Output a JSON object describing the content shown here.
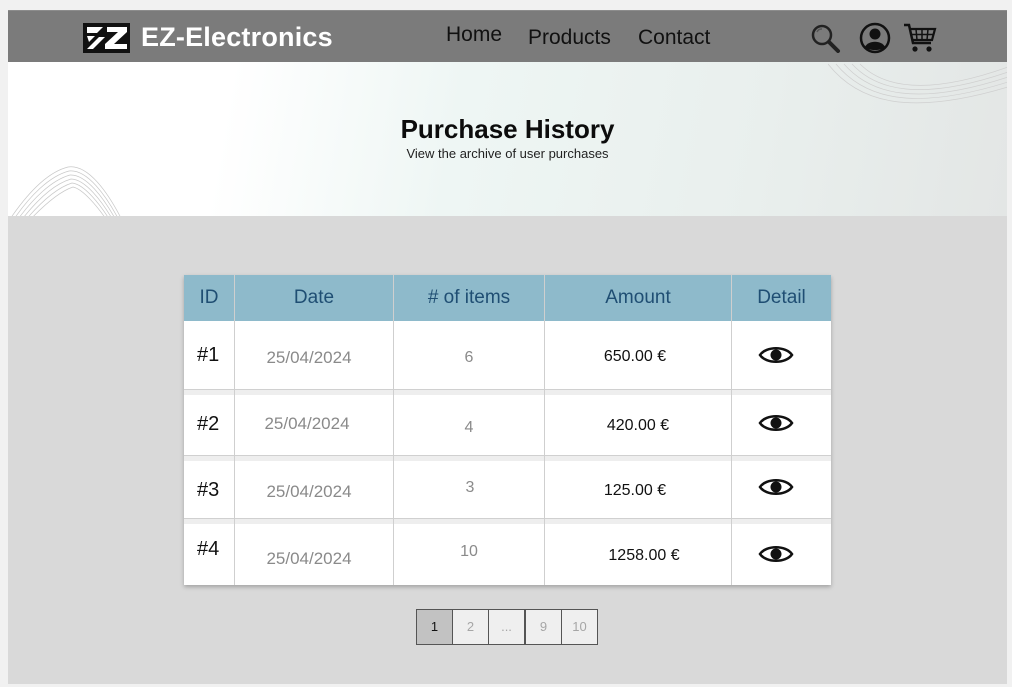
{
  "header": {
    "brand": "EZ-Electronics",
    "nav": {
      "home": "Home",
      "products": "Products",
      "contact": "Contact"
    },
    "icons": [
      "search-icon",
      "user-account-icon",
      "shopping-cart-icon"
    ]
  },
  "hero": {
    "title": "Purchase History",
    "subtitle": "View the archive of user purchases"
  },
  "table": {
    "headers": {
      "id": "ID",
      "date": "Date",
      "items": "# of items",
      "amount": "Amount",
      "detail": "Detail"
    },
    "rows": [
      {
        "id": "#1",
        "date": "25/04/2024",
        "items": "6",
        "amount": "650.00 €"
      },
      {
        "id": "#2",
        "date": "25/04/2024",
        "items": "4",
        "amount": "420.00 €"
      },
      {
        "id": "#3",
        "date": "25/04/2024",
        "items": "3",
        "amount": "125.00 €"
      },
      {
        "id": "#4",
        "date": "25/04/2024",
        "items": "10",
        "amount": "1258.00 €"
      }
    ],
    "detail_icon": "eye-icon"
  },
  "pagination": {
    "pages": [
      "1",
      "2",
      "...",
      "9",
      "10"
    ],
    "current": "1"
  },
  "colors": {
    "header_bg": "#7b7b7b",
    "table_header_bg": "#8ebacb",
    "table_header_text": "#1f4e73",
    "page_bg": "#d9d9d9"
  }
}
